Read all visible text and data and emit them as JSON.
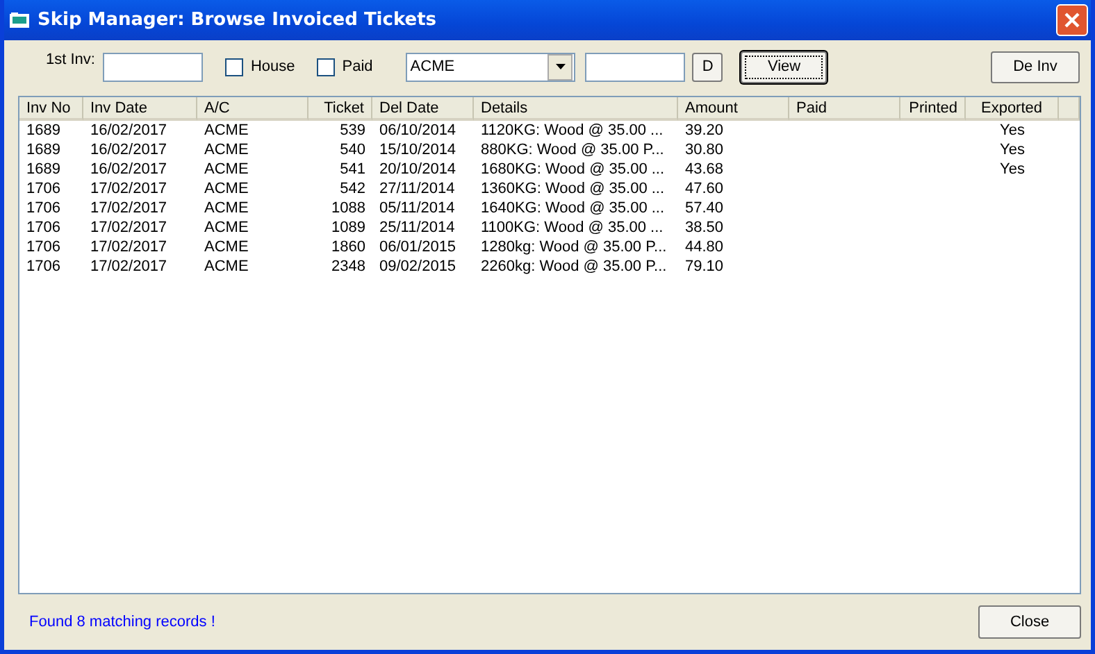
{
  "window": {
    "title": "Skip Manager: Browse Invoiced Tickets"
  },
  "filters": {
    "first_inv": {
      "label": "1st Inv:"
    },
    "checkboxes": [
      {
        "label": "House",
        "checked": false
      },
      {
        "label": "Paid",
        "checked": false
      }
    ],
    "account": {
      "value": "ACME"
    },
    "date_button": {
      "label": "D"
    },
    "view_button": {
      "label": "View",
      "focused": true
    },
    "deinv_button": {
      "label": "De Inv"
    }
  },
  "table": {
    "columns": [
      "Inv No",
      "Inv Date",
      "A/C",
      "Ticket",
      "Del Date",
      "Details",
      "Amount",
      "Paid",
      "Printed",
      "Exported"
    ],
    "rows": [
      [
        "1689",
        "16/02/2017",
        "ACME",
        "539",
        "06/10/2014",
        "1120KG: Wood @ 35.00 ...",
        "39.20",
        null,
        null,
        "Yes"
      ],
      [
        "1689",
        "16/02/2017",
        "ACME",
        "540",
        "15/10/2014",
        "880KG: Wood @ 35.00 P...",
        "30.80",
        null,
        null,
        "Yes"
      ],
      [
        "1689",
        "16/02/2017",
        "ACME",
        "541",
        "20/10/2014",
        "1680KG: Wood @ 35.00 ...",
        "43.68",
        null,
        null,
        "Yes"
      ],
      [
        "1706",
        "17/02/2017",
        "ACME",
        "542",
        "27/11/2014",
        "1360KG: Wood @ 35.00 ...",
        "47.60"
      ],
      [
        "1706",
        "17/02/2017",
        "ACME",
        "1088",
        "05/11/2014",
        "1640KG: Wood @ 35.00 ...",
        "57.40"
      ],
      [
        "1706",
        "17/02/2017",
        "ACME",
        "1089",
        "25/11/2014",
        "1100KG: Wood @ 35.00 ...",
        "38.50"
      ],
      [
        "1706",
        "17/02/2017",
        "ACME",
        "1860",
        "06/01/2015",
        "1280kg: Wood @ 35.00 P...",
        "44.80"
      ],
      [
        "1706",
        "17/02/2017",
        "ACME",
        "2348",
        "09/02/2015",
        "2260kg: Wood @ 35.00 P...",
        "79.10"
      ]
    ]
  },
  "status": {
    "message": "Found 8 matching records !"
  },
  "close_button": {
    "label": "Close"
  }
}
